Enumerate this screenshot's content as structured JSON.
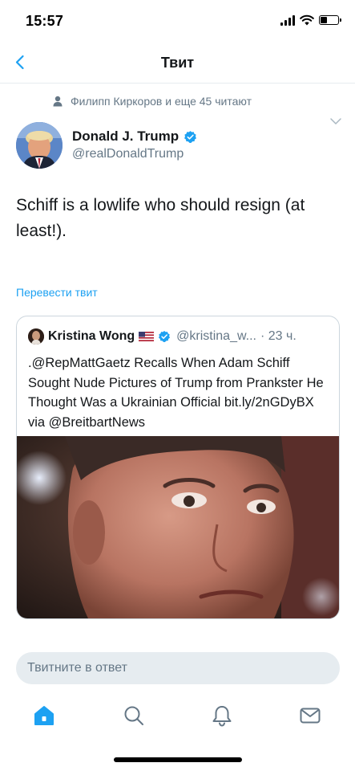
{
  "status_bar": {
    "time": "15:57"
  },
  "nav": {
    "title": "Твит",
    "back_icon": "chevron-left-icon"
  },
  "social_context": {
    "text": "Филипп Киркоров и еще 45 читают",
    "icon": "person-icon"
  },
  "tweet": {
    "author_name": "Donald J. Trump",
    "author_handle": "@realDonaldTrump",
    "text": "Schiff is a lowlife who should resign (at least!).",
    "translate_label": "Перевести твит"
  },
  "quote": {
    "author_name": "Kristina Wong",
    "author_handle": "@kristina_w...",
    "time": "· 23 ч.",
    "text": ".@RepMattGaetz Recalls When Adam Schiff Sought Nude Pictures of Trump from Prankster He Thought Was a Ukrainian Official bit.ly/2nGDyBX via @BreitbartNews"
  },
  "reply": {
    "placeholder": "Твитните в ответ"
  },
  "tabs": [
    "home-icon",
    "search-icon",
    "notifications-icon",
    "messages-icon"
  ],
  "colors": {
    "accent": "#1da1f2",
    "secondary_text": "#657786",
    "border": "#ccd6dd"
  }
}
